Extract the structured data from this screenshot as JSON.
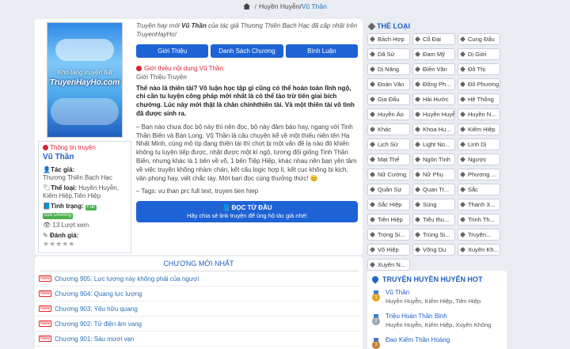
{
  "breadcrumb": {
    "sep1": "/",
    "item1": "Huyền Huyễn",
    "sep2": "/",
    "current": "Vũ Thần"
  },
  "cover": {
    "line1": "Kho tàng truyện full",
    "line2": "TruyenHayHo.com"
  },
  "story_info": {
    "heading": "Thông tin truyện",
    "title": "Vũ Thần",
    "author_label": "Tác giả:",
    "author": "Thương Thiên Bạch Hạc",
    "genre_label": "Thể loại:",
    "genres": "Huyền Huyễn, Kiếm Hiệp,Tiên Hiệp",
    "status_label": "Tình trạng:",
    "status": "Full",
    "chapters": "828 Chương",
    "views": "13 Lượt xem",
    "rating_label": "Đánh giá:",
    "rating": "0 / 5",
    "stars": "★★★★★"
  },
  "intro": {
    "pre": "Truyện hay mới ",
    "title": "Vũ Thần",
    "mid": " của tác giả Thương Thiên Bạch Hạc đã cập nhật trên TruyenHayHo!"
  },
  "tabs": [
    "Giới Thiệu",
    "Danh Sách Chương",
    "Bình Luận"
  ],
  "section": {
    "title": "Giới thiệu nội dung Vũ Thần:",
    "sub": "Giới Thiệu Truyện"
  },
  "description": {
    "bold": "Thế nào là thiên tài? Vô luận học tập gì cũng có thể hoàn toàn lĩnh ngộ, chỉ cần tu luyện công pháp mới nhất là có thể tảo trừ tiến giai bích chướng. Lúc này mới thật là chân chínhthiên tài. Và một thiên tài vô tình đã được sinh ra.",
    "body": "– Bạn nào chưa đọc bộ này thì nên đọc, bộ này đảm bảo hay, ngang với Tinh Thần Biến và Bàn Long. Vũ Thần là câu chuyện kể về một thiếu niên tên Hạ Nhất Minh, cùng mô típ đang thiên tài thì chợt bị một vấn đề lạ nào đó khiến không tu luyện tiếp được, nhặt được một kì ngộ, tương đối giống Tinh Thần Biến, nhưng khác là 1 bên về võ, 1 bên Tiệp Hiệp, khác nhau nên bạn yên tâm về việc truyện không nhàm chán, kết cấu logic hợp lí, kết cục không bị kịch, văn phong hay, viết chắc tay. Mời bạn đọc cùng thưởng thức! 😊",
    "tags": "– Tags: vu than prc full text, truyen tien hiep"
  },
  "read_button": {
    "main": "ĐỌC TỪ ĐẦU",
    "sub": "Hãy chia sẻ link truyện để ủng hộ tác giả nhé!"
  },
  "latest": {
    "title": "CHƯƠNG MỚI NHẤT",
    "badge": "New",
    "items": [
      "Chương 905: Lực lượng này không phải của ngươi",
      "Chương 904: Quang lực lượng",
      "Chương 903: Yếu hữu quang",
      "Chương 902: Tử điện âm vang",
      "Chương 901: Sáu mươi vạn"
    ]
  },
  "genres_panel": {
    "title": "THỂ LOẠI",
    "items": [
      "Bách Hợp",
      "Cổ Đại",
      "Cung Đấu",
      "Dã Sử",
      "Đam Mỹ",
      "Dị Giới",
      "Dị Năng",
      "Điền Văn",
      "Đô Thị",
      "Đoản Văn",
      "Đông Ph...",
      "Đô Phương...",
      "Gia Đấu",
      "Hài Hước",
      "Hệ Thống",
      "Huyền Ảo",
      "Huyền Huyễn",
      "Huyền N...",
      "Khác",
      "Khoa Hu...",
      "Kiếm Hiệp",
      "Lịch Sử",
      "Light No...",
      "Linh Dị",
      "Mạt Thế",
      "Ngôn Tình",
      "Ngược",
      "Nữ Cường",
      "Nữ Phụ",
      "Phương ...",
      "Quân Sự",
      "Quan Tr...",
      "Sắc",
      "Sắc Hiệp",
      "Sủng",
      "Thanh X...",
      "Tiên Hiệp",
      "Tiểu thu...",
      "Trinh Th...",
      "Trọng Si...",
      "Trùng Si...",
      "Truyện...",
      "Võ Hiệp",
      "Võng Du",
      "Xuyên Kh...",
      "Xuyên N..."
    ]
  },
  "hot": {
    "title": "TRUYỆN HUYỀN HUYỄN HOT",
    "items": [
      {
        "rank": "1",
        "title": "Vũ Thần",
        "genres": "Huyền Huyễn, Kiếm Hiệp, Tiên Hiệp",
        "color": "#e6a21a"
      },
      {
        "rank": "2",
        "title": "Triệu Hoán Thần Binh",
        "genres": "Huyền Huyễn, Kiếm Hiệp, Xuyên Không",
        "color": "#9aa4b0"
      },
      {
        "rank": "3",
        "title": "Đao Kiếm Thần Hoàng",
        "genres": "",
        "color": "#c77b3a"
      }
    ]
  }
}
